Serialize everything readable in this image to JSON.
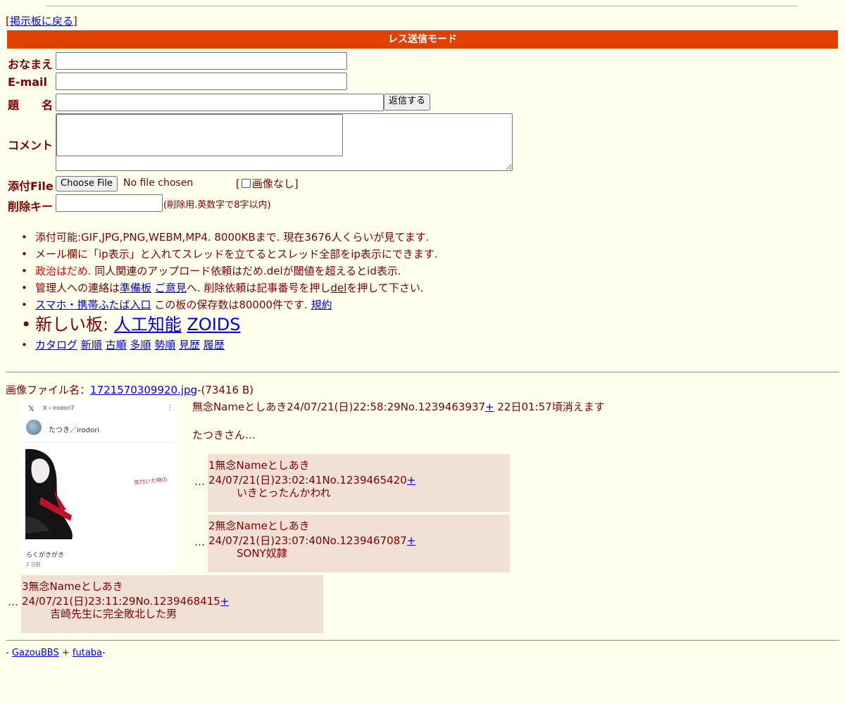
{
  "nav": {
    "back_label": "掲示板に戻る"
  },
  "form": {
    "mode_title": "レス送信モード",
    "name_label": "おなまえ",
    "email_label": "E-mail",
    "subject_label": "題　　名",
    "comment_label": "コメント",
    "file_label": "添付File",
    "delkey_label": "削除キー",
    "submit_label": "返信する",
    "choose_file_label": "Choose File",
    "no_file_text": "No file chosen",
    "no_image_label": "画像なし",
    "delkey_note": "(削除用.英数字で8字以内)"
  },
  "rules": {
    "r1": "添付可能:GIF,JPG,PNG,WEBM,MP4. 8000KBまで. 現在3676人くらいが見てます.",
    "r2": "メール欄に「ip表示」と入れてスレッドを立てるとスレッド全部をip表示にできます.",
    "r3_red": "政治はだめ.",
    "r3_rest": " 同人関連のアップロード依頼はだめ.delが閾値を超えるとid表示.",
    "r4_pre": "管理人への連絡は",
    "r4_link1": "準備板",
    "r4_link2": "ご意見",
    "r4_mid": "へ. 削除依頼は記事番号を押し",
    "r4_link3": "del",
    "r4_post": "を押して下さい.",
    "r5_link1": "スマホ・携帯ふたば入口",
    "r5_mid": " この板の保存数は80000件です. ",
    "r5_link2": "規約",
    "r6_pre": "新しい板: ",
    "r6_link1": "人工知能",
    "r6_link2": "ZOIDS",
    "r7_links": [
      "カタログ",
      "新順",
      "古順",
      "多順",
      "勢順",
      "見歴",
      "履歴"
    ]
  },
  "thread": {
    "file_prefix": "画像ファイル名：",
    "file_name": "1721570309920.jpg",
    "file_size": "-(73416 B)",
    "thumb": {
      "x_logo": "𝕏",
      "crumb": "X › irodori7",
      "menu": "⋮",
      "user": "たつき／irodori",
      "art_text": "気付いた時の",
      "caption": "らくがきがき",
      "time": "2 日前"
    },
    "op": {
      "header": "無念Nameとしあき24/07/21(日)22:58:29No.1239463937",
      "plus": "+",
      "expire": " 22日01:57頃消えます",
      "body": "たつきさん…"
    },
    "replies": [
      {
        "mark": "…",
        "header": "1無念Nameとしあき24/07/21(日)23:02:41No.1239465420",
        "plus": "+",
        "body": "いきとったんかわれ"
      },
      {
        "mark": "…",
        "header": "2無念Nameとしあき24/07/21(日)23:07:40No.1239467087",
        "plus": "+",
        "body": "SONY奴隷"
      },
      {
        "mark": "…",
        "header": "3無念Nameとしあき24/07/21(日)23:11:29No.1239468415",
        "plus": "+",
        "body": "吉崎先生に完全敗北した男"
      }
    ]
  },
  "footer": {
    "prefix": "- ",
    "link1": "GazouBBS",
    "plus": " + ",
    "link2": "futaba",
    "suffix": "-"
  },
  "colors": {
    "background": "#ffffee",
    "text": "#800000",
    "mode_bar": "#e04000",
    "reply_bg": "#f0e0d6",
    "link": "#0000ee"
  }
}
